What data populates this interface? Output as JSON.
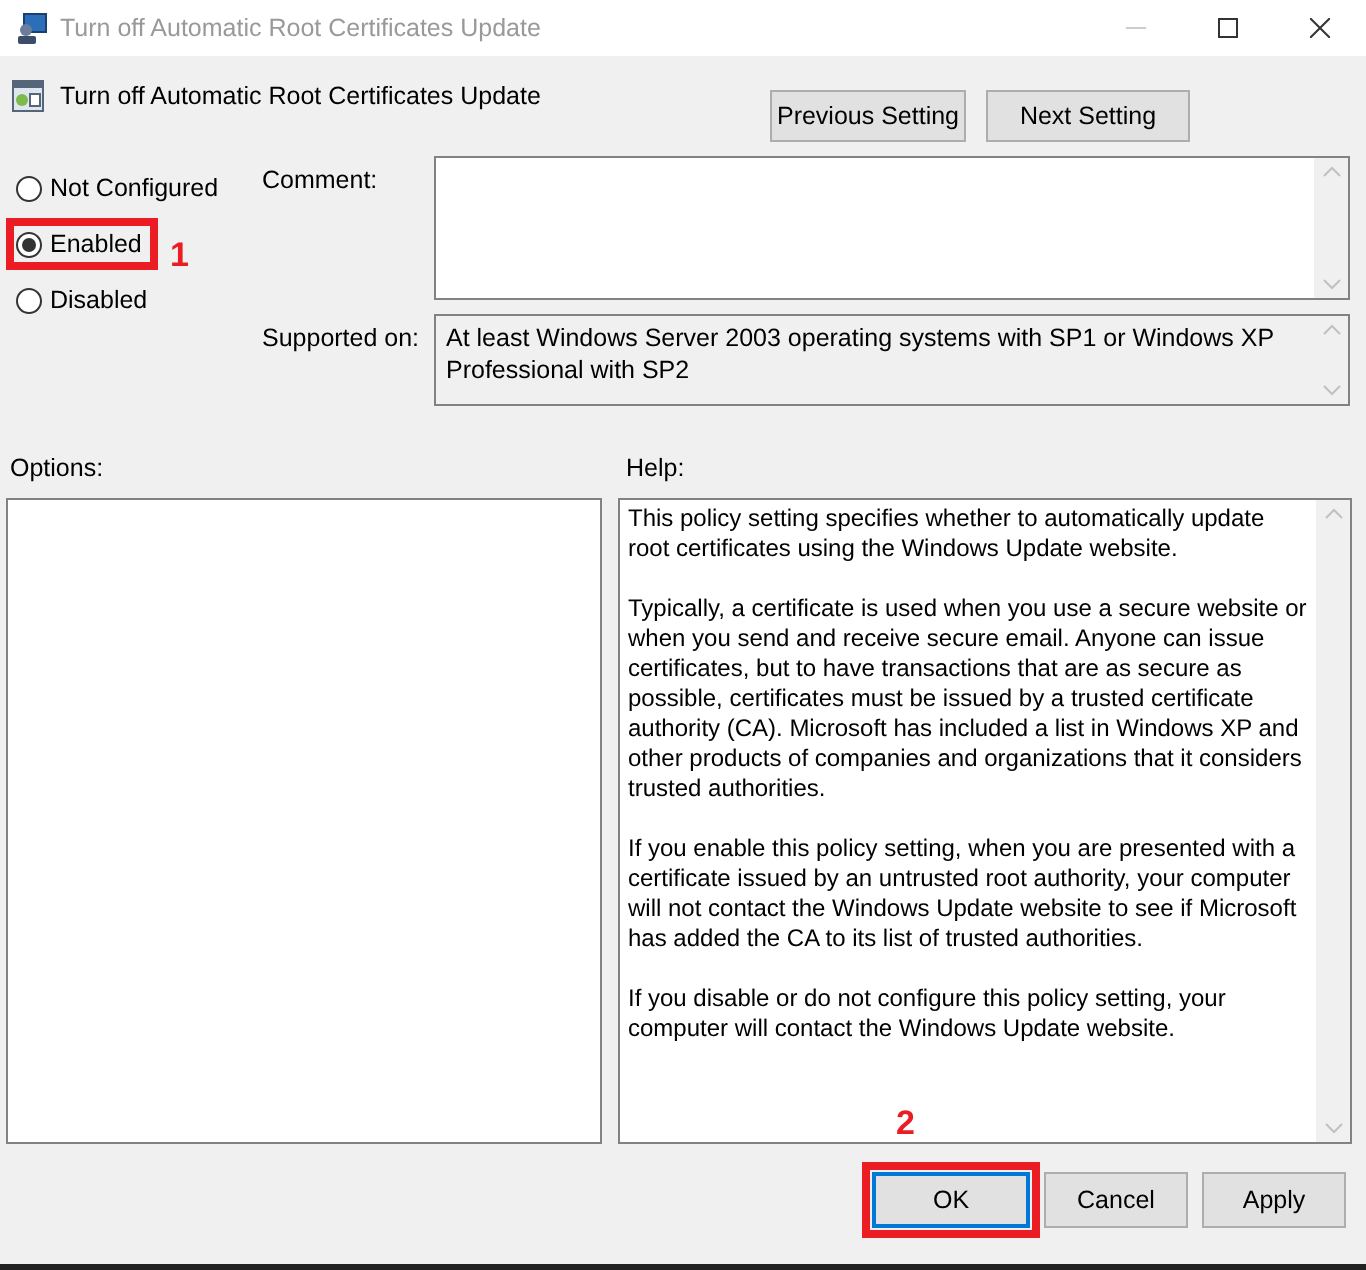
{
  "window": {
    "title": "Turn off Automatic Root Certificates Update"
  },
  "header": {
    "title": "Turn off Automatic Root Certificates Update",
    "buttons": [
      "Previous Setting",
      "Next Setting"
    ]
  },
  "state_options": [
    {
      "label": "Not Configured",
      "selected": false
    },
    {
      "label": "Enabled",
      "selected": true,
      "annotation": "1"
    },
    {
      "label": "Disabled",
      "selected": false
    }
  ],
  "comment": {
    "label": "Comment:"
  },
  "supported_on": {
    "label": "Supported on:",
    "value": "At least Windows Server 2003 operating systems with SP1 or Windows XP Professional with SP2"
  },
  "options": {
    "label": "Options:"
  },
  "help": {
    "label": "Help:",
    "paragraphs": [
      "This policy setting specifies whether to automatically update root certificates using the Windows Update website.",
      "Typically, a certificate is used when you use a secure website or when you send and receive secure email. Anyone can issue certificates, but to have transactions that are as secure as possible, certificates must be issued by a trusted certificate authority (CA). Microsoft has included a list in Windows XP and other products of companies and organizations that it considers trusted authorities.",
      "If you enable this policy setting, when you are presented with a certificate issued by an untrusted root authority, your computer will not contact the Windows Update website to see if Microsoft has added the CA to its list of trusted authorities.",
      "If you disable or do not configure this policy setting, your computer will contact the Windows Update website."
    ]
  },
  "footer_buttons": [
    {
      "label": "OK",
      "selected": true,
      "annotation": "2"
    },
    {
      "label": "Cancel",
      "selected": false
    },
    {
      "label": "Apply",
      "selected": false
    }
  ]
}
